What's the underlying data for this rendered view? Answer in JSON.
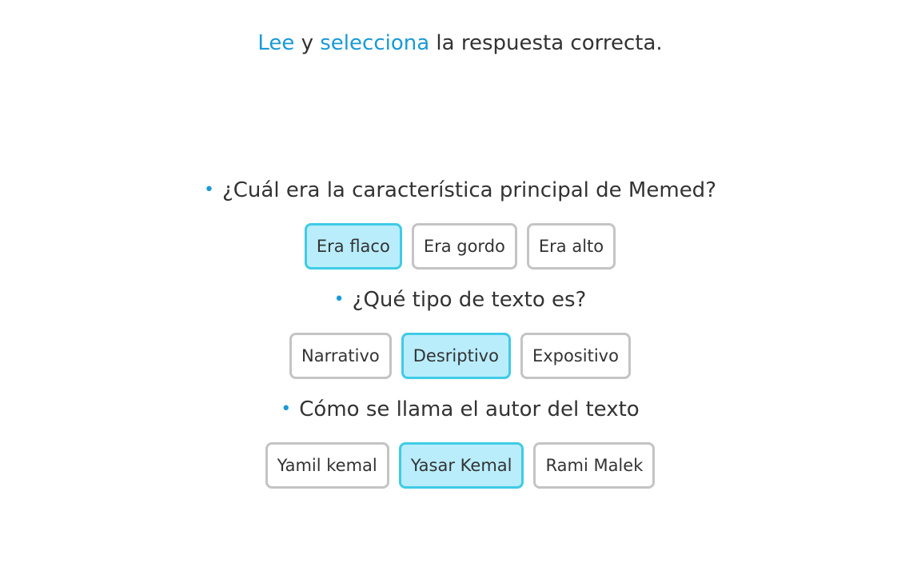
{
  "instruction": {
    "word1": "Lee",
    "connector": " y ",
    "word2": "selecciona",
    "rest": " la respuesta correcta."
  },
  "questions": [
    {
      "text": "¿Cuál era la característica principal de Memed?",
      "options": [
        {
          "label": "Era flaco",
          "selected": true
        },
        {
          "label": "Era gordo",
          "selected": false
        },
        {
          "label": "Era alto",
          "selected": false
        }
      ]
    },
    {
      "text": "¿Qué tipo de texto es?",
      "options": [
        {
          "label": "Narrativo",
          "selected": false
        },
        {
          "label": "Desriptivo",
          "selected": true
        },
        {
          "label": "Expositivo",
          "selected": false
        }
      ]
    },
    {
      "text": "Cómo se llama el autor del texto",
      "options": [
        {
          "label": "Yamil kemal",
          "selected": false
        },
        {
          "label": "Yasar Kemal",
          "selected": true
        },
        {
          "label": "Rami Malek",
          "selected": false
        }
      ]
    }
  ],
  "colors": {
    "accent": "#1a9ad6",
    "selected_fill": "#b9edfc",
    "selected_border": "#3fcbe6",
    "default_border": "#c4c4c4"
  }
}
